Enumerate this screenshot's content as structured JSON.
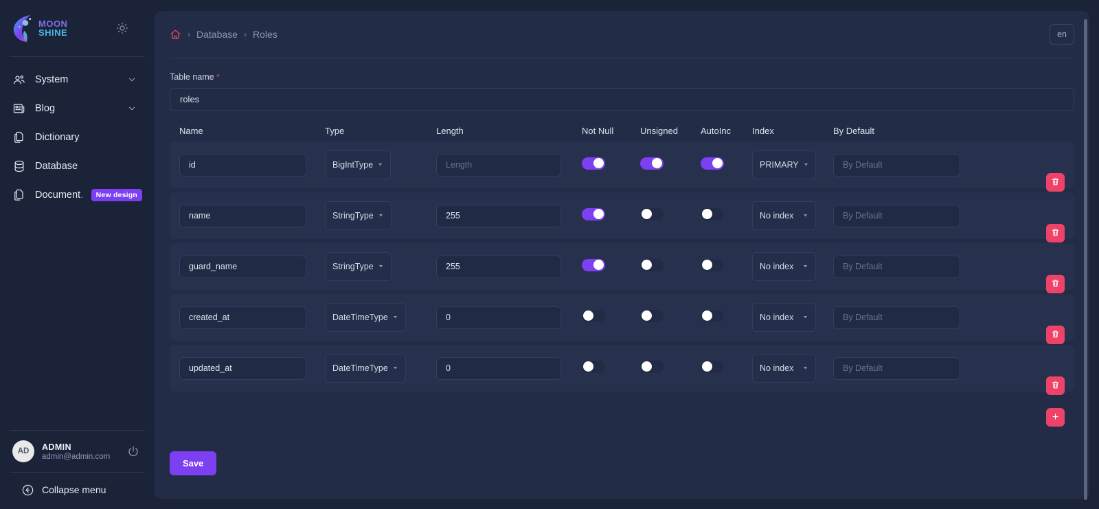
{
  "brand": {
    "line1": "MOON",
    "line2": "SHINE",
    "accent": "#7c3ff2"
  },
  "sidebar": {
    "theme_icon": "sun-icon",
    "items": [
      {
        "label": "System",
        "icon": "users-icon",
        "expandable": true,
        "badge": null
      },
      {
        "label": "Blog",
        "icon": "newspaper-icon",
        "expandable": true,
        "badge": null
      },
      {
        "label": "Dictionary",
        "icon": "copy-file-icon",
        "expandable": false,
        "badge": null
      },
      {
        "label": "Database",
        "icon": "database-icon",
        "expandable": false,
        "badge": null
      },
      {
        "label": "Document…",
        "icon": "copy-file-icon",
        "expandable": false,
        "badge": "New design"
      }
    ],
    "user": {
      "initials": "AD",
      "name": "ADMIN",
      "email": "admin@admin.com",
      "power_icon": "power-icon"
    },
    "collapse": {
      "label": "Collapse menu",
      "icon": "arrow-left-circle-icon"
    }
  },
  "topbar": {
    "breadcrumb": {
      "home_icon": "home-icon",
      "sep": "›",
      "items": [
        "Database",
        "Roles"
      ]
    },
    "lang": "en"
  },
  "form": {
    "table_name_label": "Table name",
    "required_mark": "*",
    "table_name_value": "roles"
  },
  "table": {
    "headers": [
      "Name",
      "Type",
      "Length",
      "Not Null",
      "Unsigned",
      "AutoInc",
      "Index",
      "By Default"
    ],
    "length_placeholder": "Length",
    "default_placeholder": "By Default",
    "rows": [
      {
        "name": "id",
        "type": "BigIntType",
        "length": "",
        "length_placeholder": "Length",
        "not_null": true,
        "unsigned": true,
        "auto_inc": true,
        "index": "PRIMARY",
        "by_default": "",
        "delete_icon": "trash-icon"
      },
      {
        "name": "name",
        "type": "StringType",
        "length": "255",
        "length_placeholder": "",
        "not_null": true,
        "unsigned": false,
        "auto_inc": false,
        "index": "No index",
        "by_default": "",
        "delete_icon": "trash-icon"
      },
      {
        "name": "guard_name",
        "type": "StringType",
        "length": "255",
        "length_placeholder": "",
        "not_null": true,
        "unsigned": false,
        "auto_inc": false,
        "index": "No index",
        "by_default": "",
        "delete_icon": "trash-icon"
      },
      {
        "name": "created_at",
        "type": "DateTimeType",
        "length": "0",
        "length_placeholder": "",
        "not_null": false,
        "unsigned": false,
        "auto_inc": false,
        "index": "No index",
        "by_default": "",
        "delete_icon": "trash-icon"
      },
      {
        "name": "updated_at",
        "type": "DateTimeType",
        "length": "0",
        "length_placeholder": "",
        "not_null": false,
        "unsigned": false,
        "auto_inc": false,
        "index": "No index",
        "by_default": "",
        "delete_icon": "trash-icon"
      }
    ],
    "add_row_label": "+"
  },
  "actions": {
    "save_label": "Save"
  },
  "colors": {
    "accent_purple": "#7c3ff2",
    "accent_pink": "#ef4268",
    "bg": "#1b2339",
    "card": "#232c47",
    "row": "#27314e"
  }
}
